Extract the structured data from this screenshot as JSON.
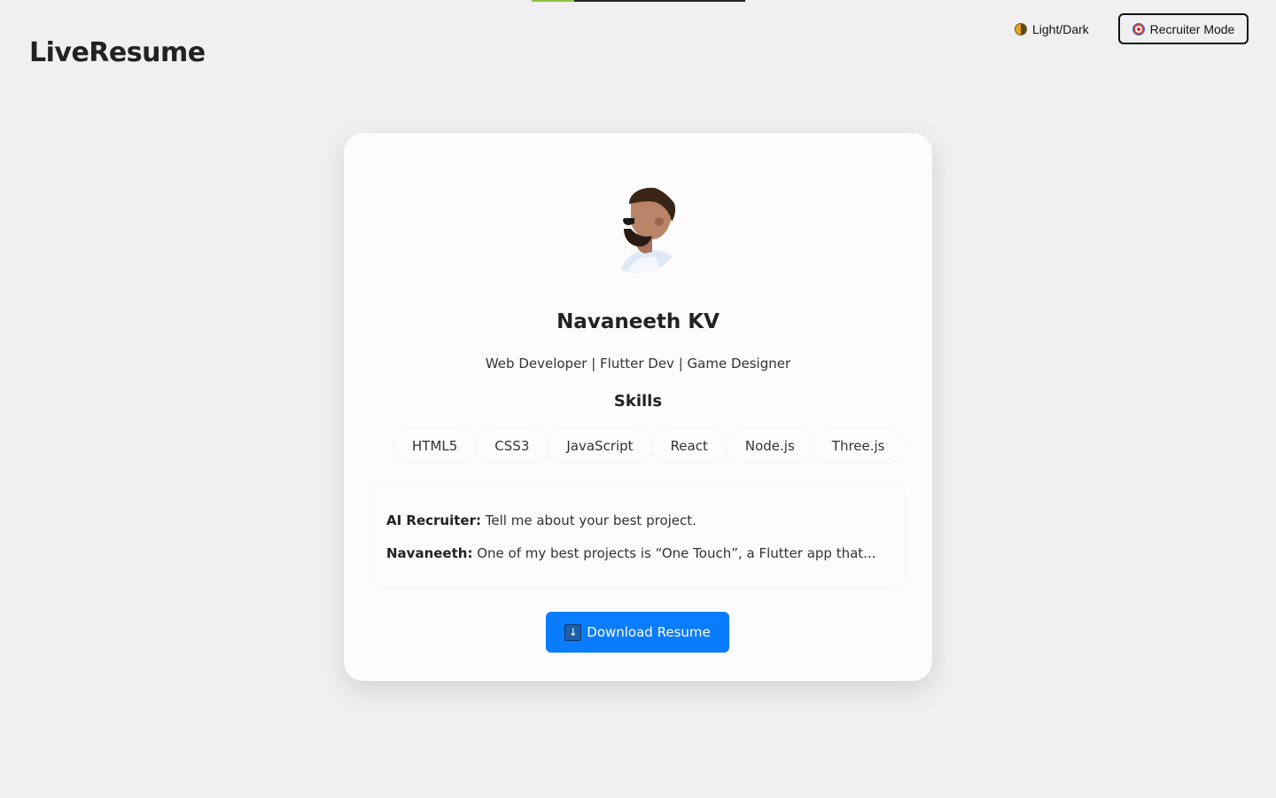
{
  "header": {
    "app_title": "LiveResume",
    "theme_toggle_label": "Light/Dark",
    "recruiter_mode_label": "Recruiter Mode",
    "page_progress": 0.2
  },
  "profile": {
    "name": "Navaneeth KV",
    "tagline": "Web Developer | Flutter Dev | Game Designer"
  },
  "skills": {
    "heading": "Skills",
    "items": [
      "HTML5",
      "CSS3",
      "JavaScript",
      "React",
      "Node.js",
      "Three.js"
    ]
  },
  "chat": {
    "lines": [
      {
        "speaker": "AI Recruiter:",
        "text": " Tell me about your best project."
      },
      {
        "speaker": "Navaneeth:",
        "text": " One of my best projects is “One Touch”, a Flutter app that..."
      }
    ]
  },
  "download": {
    "label": "Download Resume",
    "icon": "download-icon"
  },
  "colors": {
    "accent": "#0a7cff",
    "page_bg": "#f0f0f0",
    "card_bg": "#fcfcfc",
    "progress": "#8cc63f"
  }
}
